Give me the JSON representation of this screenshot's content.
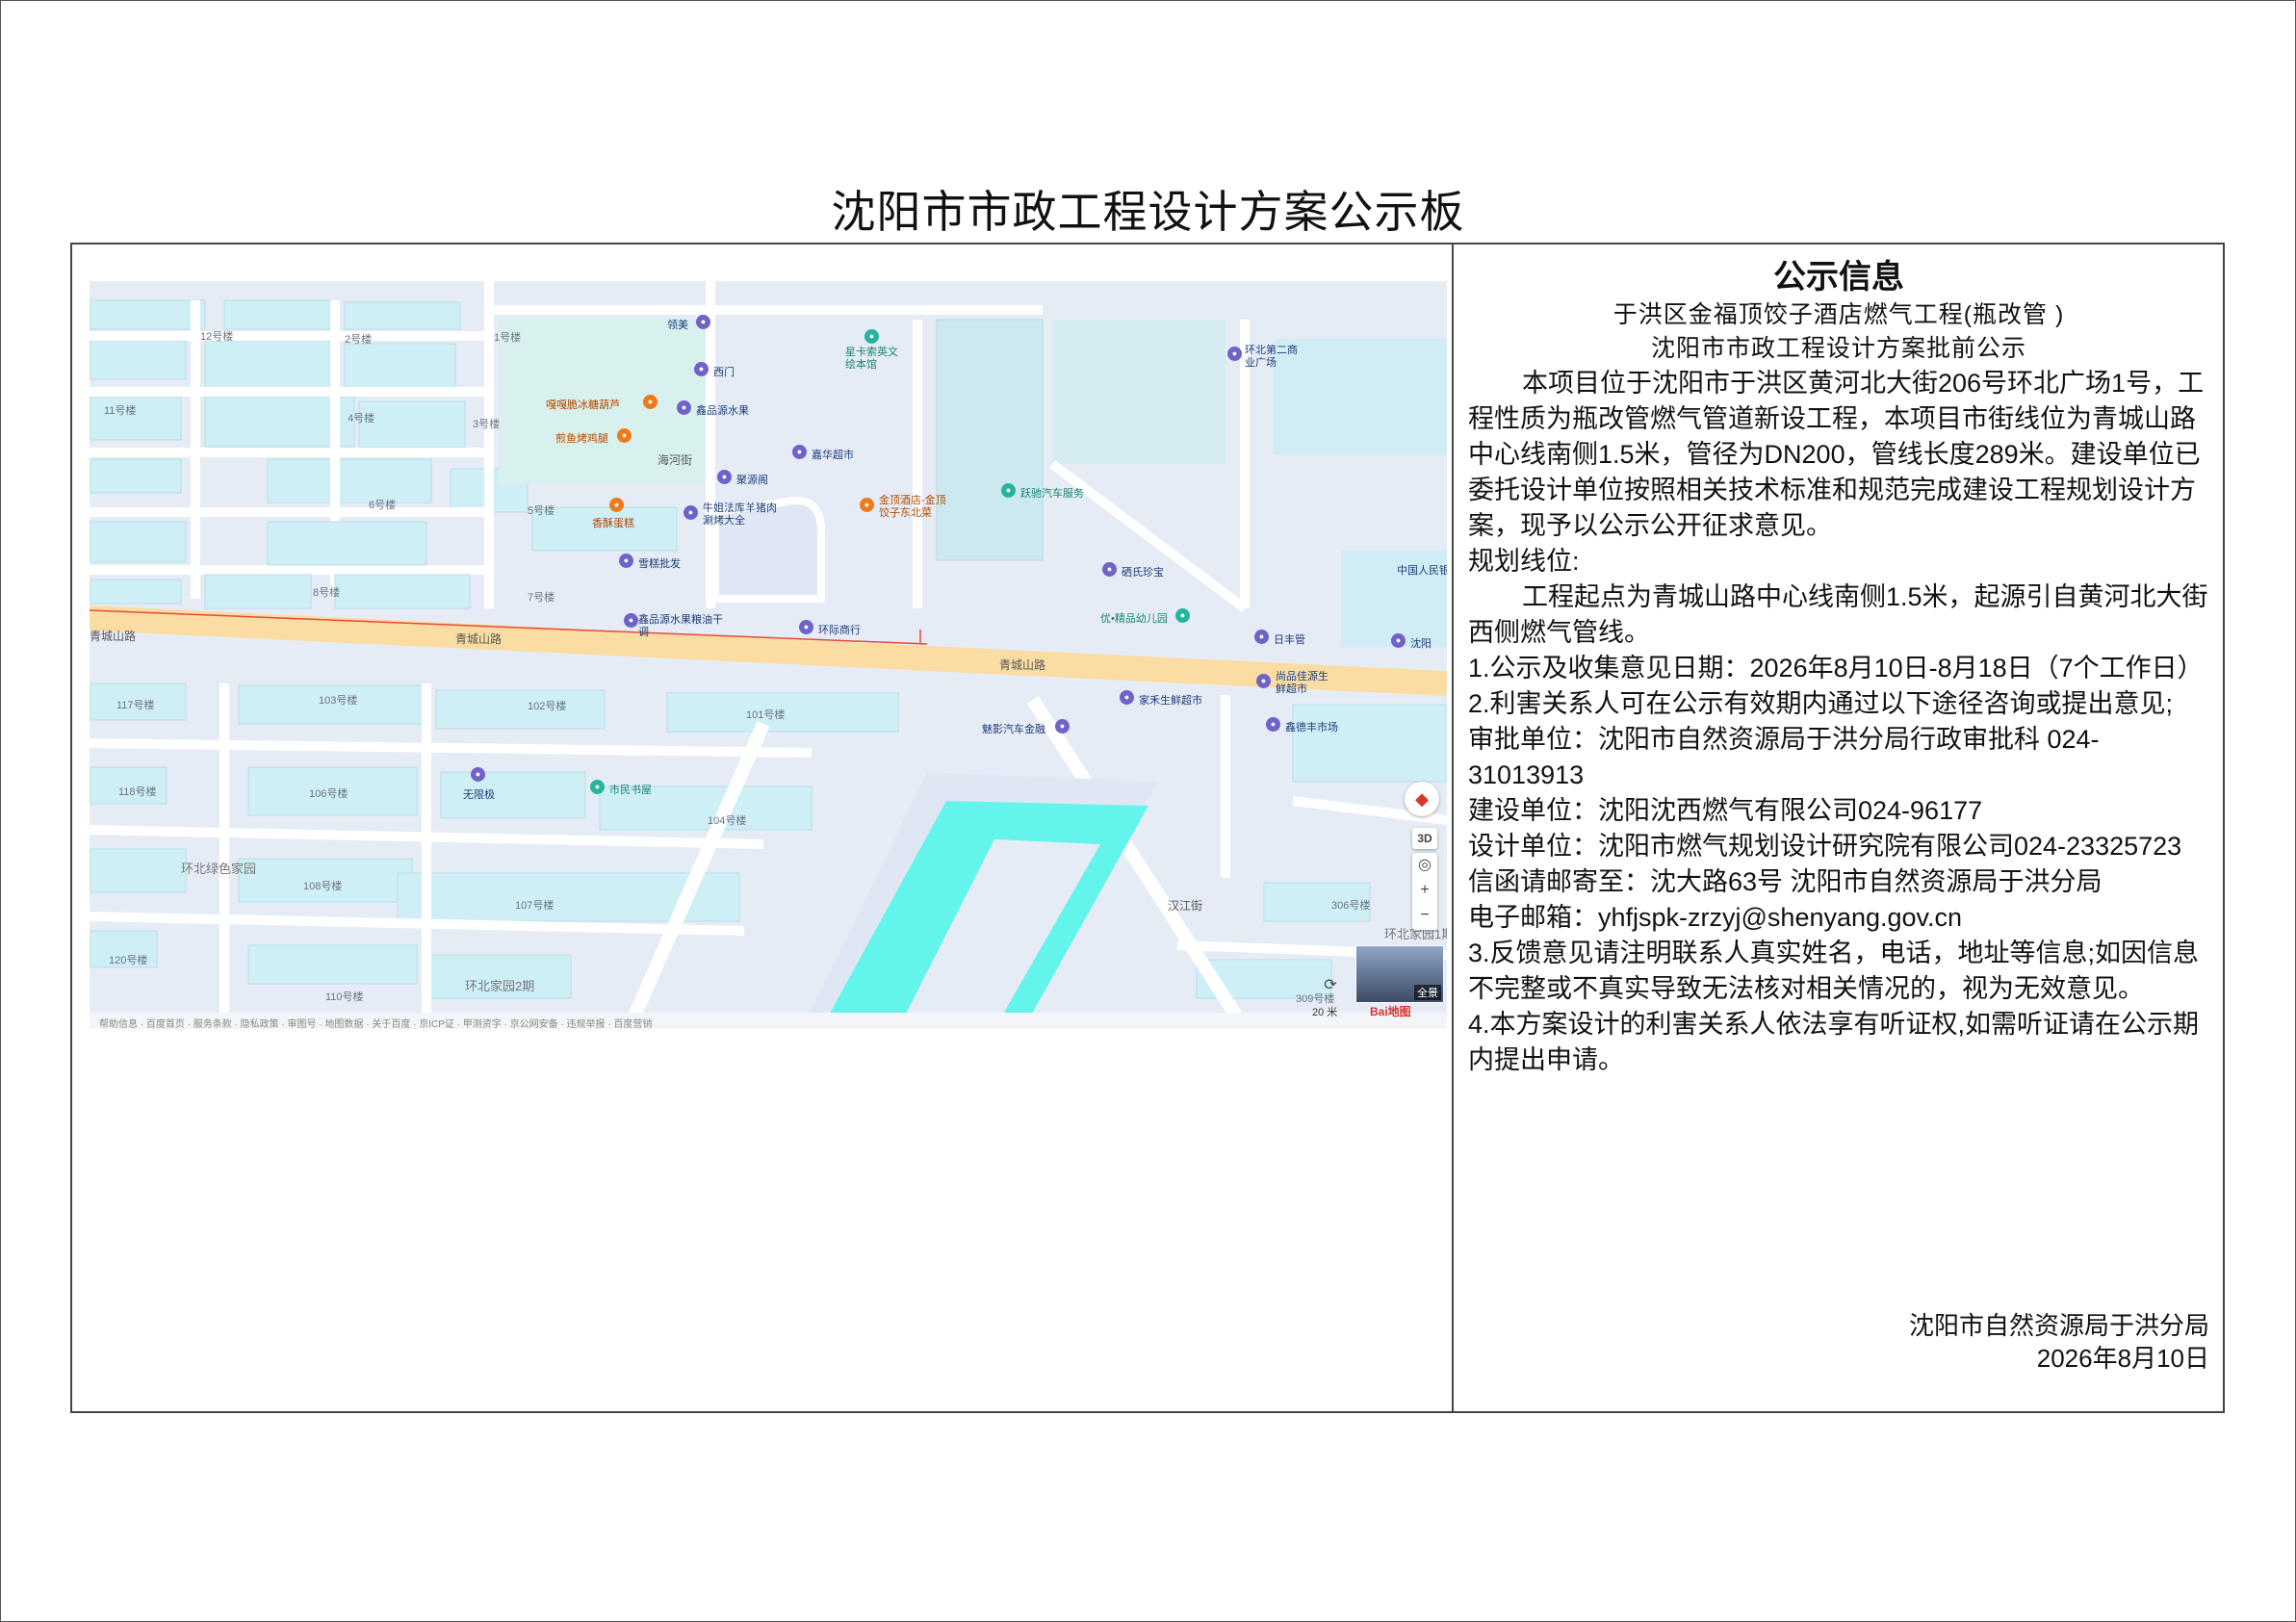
{
  "title": "沈阳市市政工程设计方案公示板",
  "map": {
    "roads": [
      "青城山路",
      "青城山路",
      "青城山路",
      "海河街",
      "汉江街",
      "环北家园2期",
      "环北绿色家园",
      "环北家园1期"
    ],
    "buildings": [
      "12号楼",
      "2号楼",
      "1号楼",
      "11号楼",
      "4号楼",
      "3号楼",
      "6号楼",
      "5号楼",
      "8号楼",
      "7号楼",
      "117号楼",
      "103号楼",
      "102号楼",
      "101号楼",
      "118号楼",
      "106号楼",
      "104号楼",
      "108号楼",
      "107号楼",
      "120号楼",
      "110号楼",
      "306号楼",
      "309号楼"
    ],
    "pois": [
      {
        "name": "领美",
        "color": "#6f63c9"
      },
      {
        "name": "西门",
        "color": "#6f63c9"
      },
      {
        "name": "星卡索英文绘本馆",
        "color": "#27b49c"
      },
      {
        "name": "环北第二商业广场",
        "color": "#6f63c9"
      },
      {
        "name": "嘎嘎脆冰糖葫芦",
        "color": "#f07a1a"
      },
      {
        "name": "鑫品源水果",
        "color": "#6f63c9"
      },
      {
        "name": "煎鱼烤鸡腿",
        "color": "#f07a1a"
      },
      {
        "name": "嘉华超市",
        "color": "#6f63c9"
      },
      {
        "name": "聚源阁",
        "color": "#6f63c9"
      },
      {
        "name": "跃驰汽车服务",
        "color": "#27b49c"
      },
      {
        "name": "香酥蛋糕",
        "color": "#f07a1a"
      },
      {
        "name": "牛姐法库羊猪肉涮烤大全",
        "color": "#6f63c9"
      },
      {
        "name": "金顶酒店-金顶饺子东北菜",
        "color": "#f07a1a"
      },
      {
        "name": "雪糕批发",
        "color": "#6f63c9"
      },
      {
        "name": "硒氏珍宝",
        "color": "#6f63c9"
      },
      {
        "name": "中国人民银行",
        "color": "#6f63c9"
      },
      {
        "name": "鑫品源水果粮油干调",
        "color": "#6f63c9"
      },
      {
        "name": "环际商行",
        "color": "#6f63c9"
      },
      {
        "name": "优•精品幼儿园",
        "color": "#27b49c"
      },
      {
        "name": "日丰管",
        "color": "#6f63c9"
      },
      {
        "name": "沈阳",
        "color": "#6f63c9"
      },
      {
        "name": "尚品佳源生鲜超市",
        "color": "#6f63c9"
      },
      {
        "name": "家禾生鲜超市",
        "color": "#6f63c9"
      },
      {
        "name": "鑫德丰市场",
        "color": "#6f63c9"
      },
      {
        "name": "魅影汽车金融",
        "color": "#6f63c9"
      },
      {
        "name": "无限极",
        "color": "#6f63c9"
      },
      {
        "name": "市民书屋",
        "color": "#27b49c"
      }
    ],
    "controls": {
      "three_d": "3D",
      "panorama": "全景",
      "scale": "20 米",
      "logo": "Bai地图"
    },
    "footer_text": "帮助信息 · 百度首页 · 服务条款 · 隐私政策 · 审图号 · 地图数据 · 关于百度 · 京ICP证 · 甲测资字 · 京公网安备 · 违规举报 · 百度营销"
  },
  "panel": {
    "heading": "公示信息",
    "subtitle1": "于洪区金福顶饺子酒店燃气工程(瓶改管 )",
    "subtitle2": "沈阳市市政工程设计方案批前公示",
    "intro": "本项目位于沈阳市于洪区黄河北大街206号环北广场1号，工程性质为瓶改管燃气管道新设工程，本项目市街线位为青城山路中心线南侧1.5米，管径为DN200，管线长度289米。建设单位已委托设计单位按照相关技术标准和规范完成建设工程规划设计方案，现予以公示公开征求意见。",
    "plan_label": "规划线位:",
    "plan_text": "工程起点为青城山路中心线南侧1.5米，起源引自黄河北大街西侧燃气管线。",
    "item1": "1.公示及收集意见日期：2026年8月10日-8月18日（7个工作日）",
    "item2": "2.利害关系人可在公示有效期内通过以下途径咨询或提出意见;",
    "approval": "审批单位：沈阳市自然资源局于洪分局行政审批科 024-31013913",
    "builder": "建设单位：沈阳沈西燃气有限公司024-96177",
    "designer": "设计单位：沈阳市燃气规划设计研究院有限公司024-23325723",
    "mail": "信函请邮寄至：沈大路63号 沈阳市自然资源局于洪分局",
    "email": "电子邮箱：yhfjspk-zrzyj@shenyang.gov.cn",
    "item3": "3.反馈意见请注明联系人真实姓名，电话，地址等信息;如因信息不完整或不真实导致无法核对相关情况的，视为无效意见。",
    "item4": "4.本方案设计的利害关系人依法享有听证权,如需听证请在公示期内提出申请。",
    "signature_org": "沈阳市自然资源局于洪分局",
    "signature_date": "2026年8月10日"
  }
}
